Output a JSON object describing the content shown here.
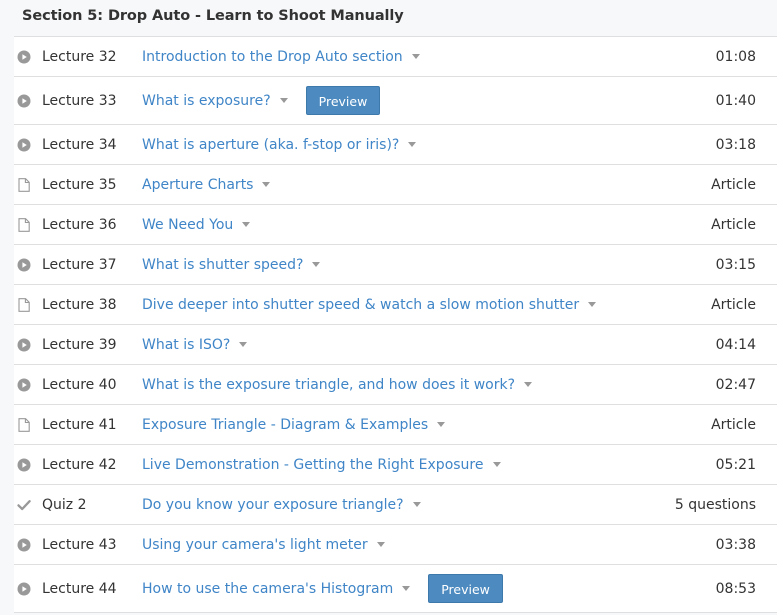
{
  "section": {
    "title": "Section 5: Drop Auto - Learn to Shoot Manually"
  },
  "colors": {
    "link": "#3f85c7",
    "text": "#333333",
    "icon": "#999999",
    "preview_button": "#4c8ac0",
    "divider": "#dedfe0"
  },
  "lectures": [
    {
      "num": "Lecture 32",
      "title": "Introduction to the Drop Auto section",
      "meta": "01:08",
      "icon": "play-icon",
      "preview": ""
    },
    {
      "num": "Lecture 33",
      "title": "What is exposure?",
      "meta": "01:40",
      "icon": "play-icon",
      "preview": "Preview"
    },
    {
      "num": "Lecture 34",
      "title": "What is aperture (aka. f-stop or iris)?",
      "meta": "03:18",
      "icon": "play-icon",
      "preview": ""
    },
    {
      "num": "Lecture 35",
      "title": "Aperture Charts",
      "meta": "Article",
      "icon": "document-icon",
      "preview": ""
    },
    {
      "num": "Lecture 36",
      "title": "We Need You",
      "meta": "Article",
      "icon": "document-icon",
      "preview": ""
    },
    {
      "num": "Lecture 37",
      "title": "What is shutter speed?",
      "meta": "03:15",
      "icon": "play-icon",
      "preview": ""
    },
    {
      "num": "Lecture 38",
      "title": "Dive deeper into shutter speed & watch a slow motion shutter",
      "meta": "Article",
      "icon": "document-icon",
      "preview": ""
    },
    {
      "num": "Lecture 39",
      "title": "What is ISO?",
      "meta": "04:14",
      "icon": "play-icon",
      "preview": ""
    },
    {
      "num": "Lecture 40",
      "title": "What is the exposure triangle, and how does it work?",
      "meta": "02:47",
      "icon": "play-icon",
      "preview": ""
    },
    {
      "num": "Lecture 41",
      "title": "Exposure Triangle - Diagram & Examples",
      "meta": "Article",
      "icon": "document-icon",
      "preview": ""
    },
    {
      "num": "Lecture 42",
      "title": "Live Demonstration - Getting the Right Exposure",
      "meta": "05:21",
      "icon": "play-icon",
      "preview": ""
    },
    {
      "num": "Quiz 2",
      "title": "Do you know your exposure triangle?",
      "meta": "5 questions",
      "icon": "checkmark-icon",
      "preview": ""
    },
    {
      "num": "Lecture 43",
      "title": "Using your camera's light meter",
      "meta": "03:38",
      "icon": "play-icon",
      "preview": ""
    },
    {
      "num": "Lecture 44",
      "title": "How to use the camera's Histogram",
      "meta": "08:53",
      "icon": "play-icon",
      "preview": "Preview"
    }
  ]
}
